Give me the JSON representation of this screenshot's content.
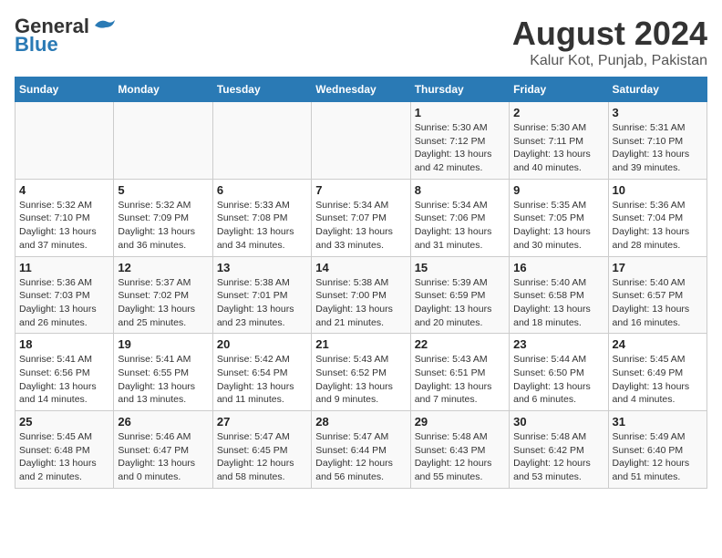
{
  "header": {
    "logo_line1": "General",
    "logo_line2": "Blue",
    "main_title": "August 2024",
    "subtitle": "Kalur Kot, Punjab, Pakistan"
  },
  "weekdays": [
    "Sunday",
    "Monday",
    "Tuesday",
    "Wednesday",
    "Thursday",
    "Friday",
    "Saturday"
  ],
  "weeks": [
    [
      {
        "day": "",
        "info": ""
      },
      {
        "day": "",
        "info": ""
      },
      {
        "day": "",
        "info": ""
      },
      {
        "day": "",
        "info": ""
      },
      {
        "day": "1",
        "info": "Sunrise: 5:30 AM\nSunset: 7:12 PM\nDaylight: 13 hours\nand 42 minutes."
      },
      {
        "day": "2",
        "info": "Sunrise: 5:30 AM\nSunset: 7:11 PM\nDaylight: 13 hours\nand 40 minutes."
      },
      {
        "day": "3",
        "info": "Sunrise: 5:31 AM\nSunset: 7:10 PM\nDaylight: 13 hours\nand 39 minutes."
      }
    ],
    [
      {
        "day": "4",
        "info": "Sunrise: 5:32 AM\nSunset: 7:10 PM\nDaylight: 13 hours\nand 37 minutes."
      },
      {
        "day": "5",
        "info": "Sunrise: 5:32 AM\nSunset: 7:09 PM\nDaylight: 13 hours\nand 36 minutes."
      },
      {
        "day": "6",
        "info": "Sunrise: 5:33 AM\nSunset: 7:08 PM\nDaylight: 13 hours\nand 34 minutes."
      },
      {
        "day": "7",
        "info": "Sunrise: 5:34 AM\nSunset: 7:07 PM\nDaylight: 13 hours\nand 33 minutes."
      },
      {
        "day": "8",
        "info": "Sunrise: 5:34 AM\nSunset: 7:06 PM\nDaylight: 13 hours\nand 31 minutes."
      },
      {
        "day": "9",
        "info": "Sunrise: 5:35 AM\nSunset: 7:05 PM\nDaylight: 13 hours\nand 30 minutes."
      },
      {
        "day": "10",
        "info": "Sunrise: 5:36 AM\nSunset: 7:04 PM\nDaylight: 13 hours\nand 28 minutes."
      }
    ],
    [
      {
        "day": "11",
        "info": "Sunrise: 5:36 AM\nSunset: 7:03 PM\nDaylight: 13 hours\nand 26 minutes."
      },
      {
        "day": "12",
        "info": "Sunrise: 5:37 AM\nSunset: 7:02 PM\nDaylight: 13 hours\nand 25 minutes."
      },
      {
        "day": "13",
        "info": "Sunrise: 5:38 AM\nSunset: 7:01 PM\nDaylight: 13 hours\nand 23 minutes."
      },
      {
        "day": "14",
        "info": "Sunrise: 5:38 AM\nSunset: 7:00 PM\nDaylight: 13 hours\nand 21 minutes."
      },
      {
        "day": "15",
        "info": "Sunrise: 5:39 AM\nSunset: 6:59 PM\nDaylight: 13 hours\nand 20 minutes."
      },
      {
        "day": "16",
        "info": "Sunrise: 5:40 AM\nSunset: 6:58 PM\nDaylight: 13 hours\nand 18 minutes."
      },
      {
        "day": "17",
        "info": "Sunrise: 5:40 AM\nSunset: 6:57 PM\nDaylight: 13 hours\nand 16 minutes."
      }
    ],
    [
      {
        "day": "18",
        "info": "Sunrise: 5:41 AM\nSunset: 6:56 PM\nDaylight: 13 hours\nand 14 minutes."
      },
      {
        "day": "19",
        "info": "Sunrise: 5:41 AM\nSunset: 6:55 PM\nDaylight: 13 hours\nand 13 minutes."
      },
      {
        "day": "20",
        "info": "Sunrise: 5:42 AM\nSunset: 6:54 PM\nDaylight: 13 hours\nand 11 minutes."
      },
      {
        "day": "21",
        "info": "Sunrise: 5:43 AM\nSunset: 6:52 PM\nDaylight: 13 hours\nand 9 minutes."
      },
      {
        "day": "22",
        "info": "Sunrise: 5:43 AM\nSunset: 6:51 PM\nDaylight: 13 hours\nand 7 minutes."
      },
      {
        "day": "23",
        "info": "Sunrise: 5:44 AM\nSunset: 6:50 PM\nDaylight: 13 hours\nand 6 minutes."
      },
      {
        "day": "24",
        "info": "Sunrise: 5:45 AM\nSunset: 6:49 PM\nDaylight: 13 hours\nand 4 minutes."
      }
    ],
    [
      {
        "day": "25",
        "info": "Sunrise: 5:45 AM\nSunset: 6:48 PM\nDaylight: 13 hours\nand 2 minutes."
      },
      {
        "day": "26",
        "info": "Sunrise: 5:46 AM\nSunset: 6:47 PM\nDaylight: 13 hours\nand 0 minutes."
      },
      {
        "day": "27",
        "info": "Sunrise: 5:47 AM\nSunset: 6:45 PM\nDaylight: 12 hours\nand 58 minutes."
      },
      {
        "day": "28",
        "info": "Sunrise: 5:47 AM\nSunset: 6:44 PM\nDaylight: 12 hours\nand 56 minutes."
      },
      {
        "day": "29",
        "info": "Sunrise: 5:48 AM\nSunset: 6:43 PM\nDaylight: 12 hours\nand 55 minutes."
      },
      {
        "day": "30",
        "info": "Sunrise: 5:48 AM\nSunset: 6:42 PM\nDaylight: 12 hours\nand 53 minutes."
      },
      {
        "day": "31",
        "info": "Sunrise: 5:49 AM\nSunset: 6:40 PM\nDaylight: 12 hours\nand 51 minutes."
      }
    ]
  ]
}
